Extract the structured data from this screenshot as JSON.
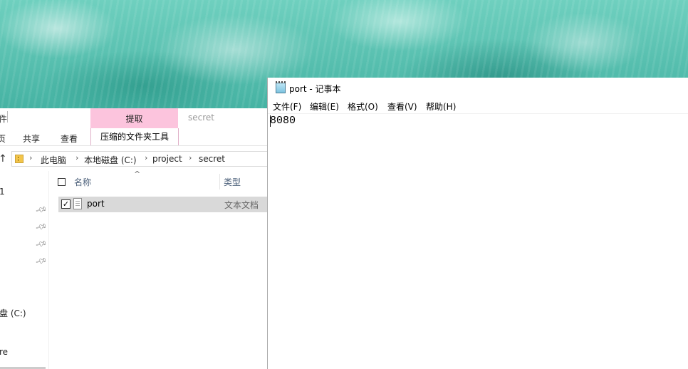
{
  "explorer": {
    "ribbon": {
      "left_cut_char": "件",
      "context_tab_label": "提取",
      "context_group_label": "secret",
      "tabs": [
        "页",
        "共享",
        "查看"
      ],
      "context_sub_label": "压缩的文件夹工具"
    },
    "address": {
      "crumbs": [
        "此电脑",
        "本地磁盘 (C:)",
        "project",
        "secret"
      ]
    },
    "nav": {
      "items": [
        "1",
        "盘 (C:)",
        "re"
      ]
    },
    "columns": {
      "name": "名称",
      "type": "类型"
    },
    "files": [
      {
        "name": "port",
        "type": "文本文档",
        "checked": true
      }
    ]
  },
  "notepad": {
    "title": "port - 记事本",
    "menu": [
      "文件(F)",
      "编辑(E)",
      "格式(O)",
      "查看(V)",
      "帮助(H)"
    ],
    "content": "8080"
  }
}
